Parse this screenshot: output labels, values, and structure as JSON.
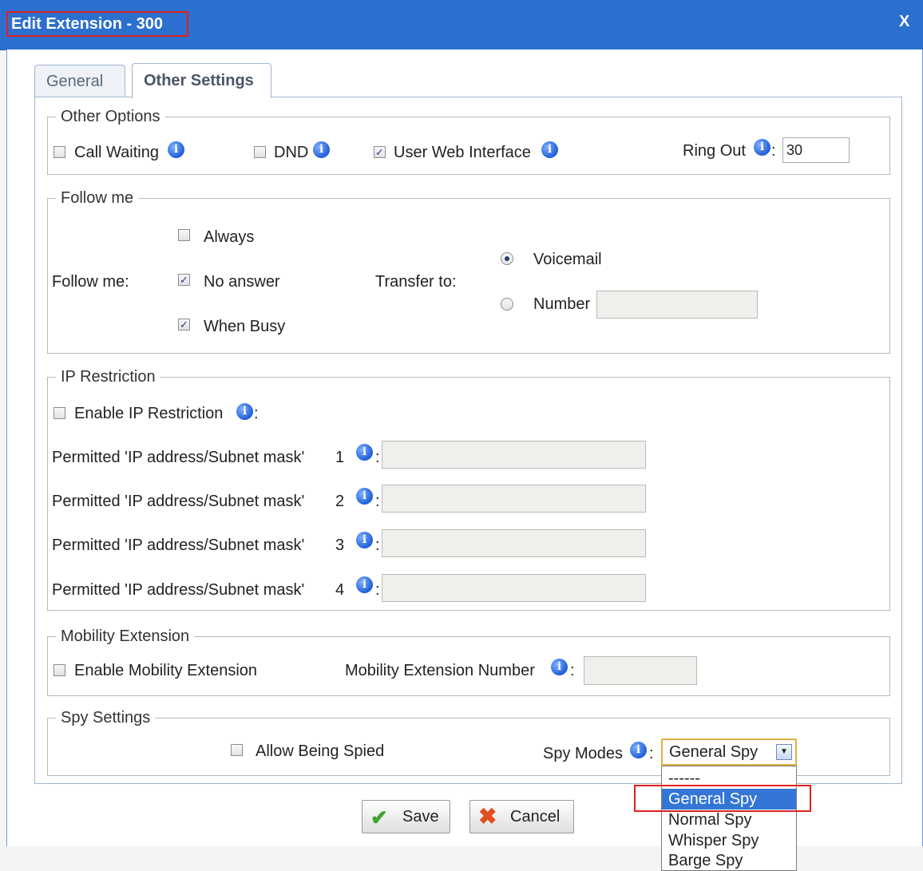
{
  "window": {
    "title": "Edit Extension - 300",
    "close": "X"
  },
  "tabs": [
    {
      "label": "General"
    },
    {
      "label": "Other Settings"
    }
  ],
  "other_options": {
    "legend": "Other Options",
    "call_waiting": {
      "label": "Call Waiting",
      "checked": false
    },
    "dnd": {
      "label": "DND",
      "checked": false
    },
    "user_web_interface": {
      "label": "User Web Interface",
      "checked": true
    },
    "ring_out": {
      "label": "Ring Out",
      "value": "30"
    }
  },
  "follow_me": {
    "legend": "Follow me",
    "label": "Follow me:",
    "always": {
      "label": "Always",
      "checked": false
    },
    "no_answer": {
      "label": "No answer",
      "checked": true
    },
    "when_busy": {
      "label": "When Busy",
      "checked": true
    },
    "transfer_to": "Transfer to:",
    "voicemail": {
      "label": "Voicemail",
      "selected": true
    },
    "number": {
      "label": "Number",
      "selected": false,
      "value": ""
    }
  },
  "ip_restriction": {
    "legend": "IP Restriction",
    "enable": {
      "label": "Enable IP Restriction",
      "checked": false
    },
    "permitted": [
      {
        "label": "Permitted 'IP address/Subnet mask'",
        "index": "1",
        "value": ""
      },
      {
        "label": "Permitted 'IP address/Subnet mask'",
        "index": "2",
        "value": ""
      },
      {
        "label": "Permitted 'IP address/Subnet mask'",
        "index": "3",
        "value": ""
      },
      {
        "label": "Permitted 'IP address/Subnet mask'",
        "index": "4",
        "value": ""
      }
    ]
  },
  "mobility": {
    "legend": "Mobility Extension",
    "enable": {
      "label": "Enable Mobility Extension",
      "checked": false
    },
    "number_label": "Mobility Extension Number",
    "number_value": ""
  },
  "spy": {
    "legend": "Spy Settings",
    "allow": {
      "label": "Allow Being Spied",
      "checked": false
    },
    "modes_label": "Spy Modes",
    "selected": "General Spy",
    "options": [
      "------",
      "General Spy",
      "Normal Spy",
      "Whisper Spy",
      "Barge Spy"
    ]
  },
  "buttons": {
    "save": "Save",
    "cancel": "Cancel"
  },
  "colors": {
    "titlebar": "#2b6fcf",
    "highlight": "#e02020",
    "info": "#1f5fd6",
    "selected_option": "#3476d6"
  }
}
